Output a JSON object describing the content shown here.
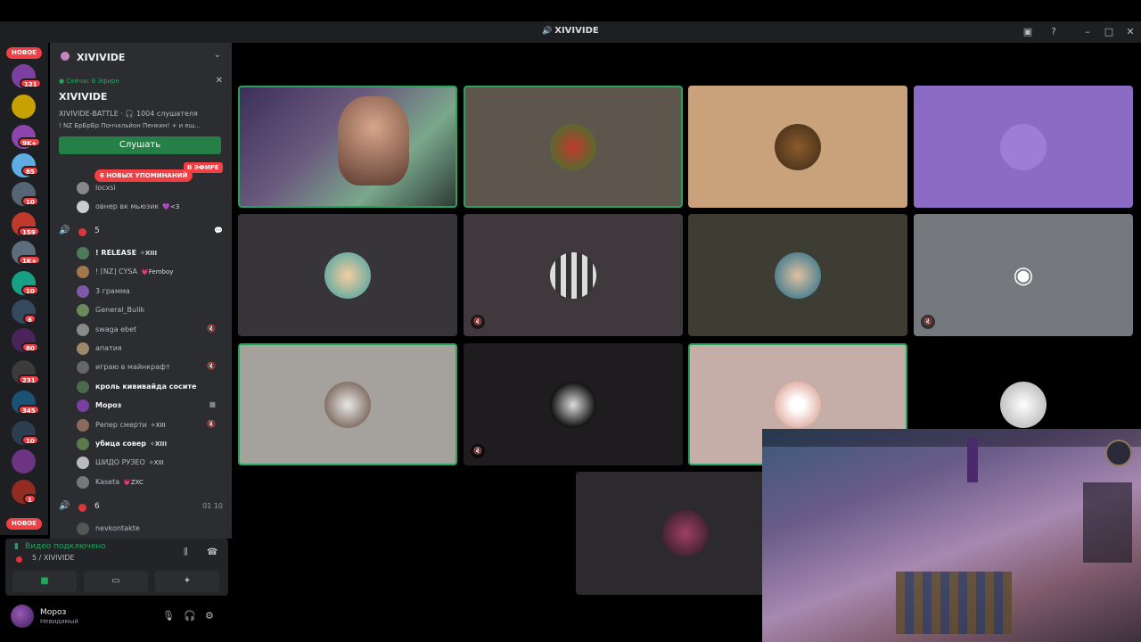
{
  "window": {
    "title": "XIVIVIDE"
  },
  "rail": {
    "new_top": "НОВОЕ",
    "new_bottom": "НОВОЕ",
    "badges": [
      "121",
      "9K+",
      "85",
      "10",
      "159",
      "1K+",
      "10",
      "6",
      "80",
      "231",
      "345",
      "10",
      "1"
    ]
  },
  "server": {
    "name": "XIVIVIDE"
  },
  "live": {
    "label": "Сейчас В Эфире",
    "title": "XIVIVIDE",
    "sub": "XIVIVIDE-BATTLE · 🎧 1004 слушателя",
    "sub2": "! NZ БрБрБр Пончальйон Пенкин! + и ещ...",
    "button": "Слушать"
  },
  "mentions": "6 НОВЫХ УПОМИНАНИЙ",
  "on_air": "В ЭФИРЕ",
  "top_members": [
    {
      "name": "locxsi"
    },
    {
      "name": "овнер вк мьюзик",
      "tag": "💜<3"
    }
  ],
  "voice_channel_1": {
    "count": "5"
  },
  "members": [
    {
      "name": "! RELEASE",
      "tag": "✧XIII",
      "bright": true
    },
    {
      "name": "! ⌈NZ⌋ CYSA",
      "tag": "💗Femboy"
    },
    {
      "name": "3 грамма"
    },
    {
      "name": "General_Bulik"
    },
    {
      "name": "swaga ebet",
      "mute": true
    },
    {
      "name": "апатия"
    },
    {
      "name": "играю в майнкрафт",
      "mute": true
    },
    {
      "name": "кроль кививайда сосите",
      "bright": true
    },
    {
      "name": "Мороз",
      "bright": true,
      "video": true
    },
    {
      "name": "Репер смерти",
      "tag": "✧XIII",
      "mute": true
    },
    {
      "name": "убица совер",
      "tag": "✧XIII",
      "bright": true
    },
    {
      "name": "ШИДО РУЗЕО",
      "tag": "✧XIII"
    },
    {
      "name": "Kaseta",
      "tag": "💗ZXC"
    }
  ],
  "voice_channel_2": {
    "count": "6",
    "limit": "01 10"
  },
  "bottom_member": {
    "name": "nevkontakte"
  },
  "voice": {
    "status": "Видео подключено",
    "channel": "5 / XIVIVIDE"
  },
  "user": {
    "name": "Мороз",
    "status": "Невидимый"
  },
  "colors": {
    "accent_green": "#23a55a",
    "danger": "#f23f43",
    "bg_dark": "#1e1f22",
    "sidebar": "#2b2d31"
  }
}
